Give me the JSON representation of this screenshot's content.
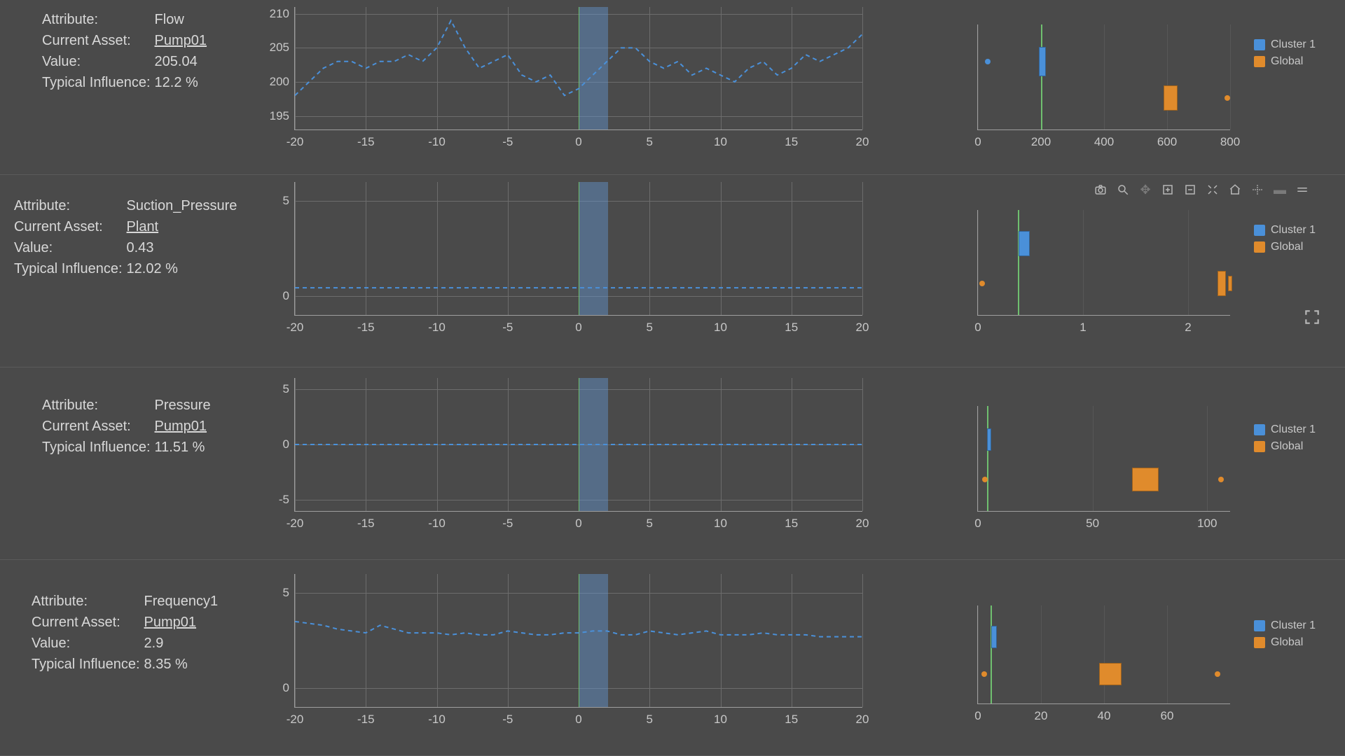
{
  "labels": {
    "attribute": "Attribute:",
    "current_asset": "Current Asset:",
    "value": "Value:",
    "typical_influence": "Typical Influence:"
  },
  "legend": {
    "cluster": "Cluster 1",
    "global": "Global"
  },
  "toolbar": {
    "camera": "camera",
    "zoom": "zoom",
    "pan": "pan",
    "zoom_in": "zoom-in",
    "zoom_out": "zoom-out",
    "autoscale": "autoscale",
    "reset": "reset",
    "spike": "spikelines",
    "hover1": "hover-closest",
    "hover2": "hover-compare",
    "expand": "expand"
  },
  "colors": {
    "cluster": "#4a90d9",
    "global": "#e08b2c",
    "marker": "#6fbf6f"
  },
  "rows": [
    {
      "attribute": "Flow",
      "asset": "Pump01",
      "value": "205.04",
      "influence": "12.2 %"
    },
    {
      "attribute": "Suction_Pressure",
      "asset": "Plant",
      "value": "0.43",
      "influence": "12.02 %"
    },
    {
      "attribute": "Pressure",
      "asset": "Pump01",
      "value": null,
      "influence": "11.51 %"
    },
    {
      "attribute": "Frequency1",
      "asset": "Pump01",
      "value": "2.9",
      "influence": "8.35 %"
    }
  ],
  "chart_data": [
    {
      "line": {
        "type": "line",
        "x_range": [
          -20,
          20
        ],
        "x_ticks": [
          -20,
          -15,
          -10,
          -5,
          0,
          5,
          10,
          15,
          20
        ],
        "y_ticks": [
          195,
          200,
          205,
          210
        ],
        "ylim": [
          193,
          211
        ],
        "highlight_x": [
          0,
          2
        ],
        "series": [
          {
            "name": "Flow",
            "x": [
              -20,
              -19,
              -18,
              -17,
              -16,
              -15,
              -14,
              -13,
              -12,
              -11,
              -10,
              -9,
              -8,
              -7,
              -6,
              -5,
              -4,
              -3,
              -2,
              -1,
              0,
              1,
              2,
              3,
              4,
              5,
              6,
              7,
              8,
              9,
              10,
              11,
              12,
              13,
              14,
              15,
              16,
              17,
              18,
              19,
              20
            ],
            "y": [
              198,
              200,
              202,
              203,
              203,
              202,
              203,
              203,
              204,
              203,
              205,
              209,
              205,
              202,
              203,
              204,
              201,
              200,
              201,
              198,
              199,
              201,
              203,
              205,
              205,
              203,
              202,
              203,
              201,
              202,
              201,
              200,
              202,
              203,
              201,
              202,
              204,
              203,
              204,
              205,
              207
            ]
          }
        ]
      },
      "box": {
        "type": "box",
        "x_range": [
          0,
          800
        ],
        "x_ticks": [
          0,
          200,
          400,
          600,
          800
        ],
        "cluster_line_x": 200,
        "items": [
          {
            "kind": "dot",
            "series": "cluster",
            "x": 30,
            "y": 0.65
          },
          {
            "kind": "box",
            "series": "cluster",
            "x": 205,
            "y": 0.65,
            "w": 8,
            "h": 40
          },
          {
            "kind": "box",
            "series": "global",
            "x": 610,
            "y": 0.3,
            "w": 18,
            "h": 34
          },
          {
            "kind": "dot",
            "series": "global",
            "x": 790,
            "y": 0.3
          }
        ]
      }
    },
    {
      "line": {
        "type": "line",
        "x_range": [
          -20,
          20
        ],
        "x_ticks": [
          -20,
          -15,
          -10,
          -5,
          0,
          5,
          10,
          15,
          20
        ],
        "y_ticks": [
          0,
          5
        ],
        "ylim": [
          -1,
          6
        ],
        "highlight_x": [
          0,
          2
        ],
        "series": [
          {
            "name": "Suction_Pressure",
            "x": [
              -20,
              -15,
              -10,
              -5,
              0,
              5,
              10,
              15,
              20
            ],
            "y": [
              0.43,
              0.43,
              0.43,
              0.43,
              0.43,
              0.43,
              0.43,
              0.43,
              0.43
            ]
          }
        ]
      },
      "box": {
        "type": "box",
        "x_range": [
          0,
          2.4
        ],
        "x_ticks": [
          0,
          1,
          2
        ],
        "cluster_line_x": 0.38,
        "items": [
          {
            "kind": "box",
            "series": "cluster",
            "x": 0.44,
            "y": 0.68,
            "w": 14,
            "h": 34
          },
          {
            "kind": "dot",
            "series": "global",
            "x": 0.04,
            "y": 0.3
          },
          {
            "kind": "box",
            "series": "global",
            "x": 2.32,
            "y": 0.3,
            "w": 10,
            "h": 34
          },
          {
            "kind": "box",
            "series": "global",
            "x": 2.4,
            "y": 0.3,
            "w": 4,
            "h": 20
          }
        ]
      }
    },
    {
      "line": {
        "type": "line",
        "x_range": [
          -20,
          20
        ],
        "x_ticks": [
          -20,
          -15,
          -10,
          -5,
          0,
          5,
          10,
          15,
          20
        ],
        "y_ticks": [
          -5,
          0,
          5
        ],
        "ylim": [
          -6,
          6
        ],
        "highlight_x": [
          0,
          2
        ],
        "series": [
          {
            "name": "Pressure",
            "x": [
              -20,
              -15,
              -10,
              -5,
              0,
              5,
              10,
              15,
              20
            ],
            "y": [
              0,
              0,
              0,
              0,
              0,
              0,
              0,
              0,
              0
            ]
          }
        ]
      },
      "box": {
        "type": "box",
        "x_range": [
          0,
          110
        ],
        "x_ticks": [
          0,
          50,
          100
        ],
        "cluster_line_x": 4,
        "items": [
          {
            "kind": "box",
            "series": "cluster",
            "x": 5,
            "y": 0.68,
            "w": 4,
            "h": 30
          },
          {
            "kind": "dot",
            "series": "global",
            "x": 3,
            "y": 0.3
          },
          {
            "kind": "box",
            "series": "global",
            "x": 73,
            "y": 0.3,
            "w": 36,
            "h": 32
          },
          {
            "kind": "dot",
            "series": "global",
            "x": 106,
            "y": 0.3
          }
        ]
      }
    },
    {
      "line": {
        "type": "line",
        "x_range": [
          -20,
          20
        ],
        "x_ticks": [
          -20,
          -15,
          -10,
          -5,
          0,
          5,
          10,
          15,
          20
        ],
        "y_ticks": [
          0,
          5
        ],
        "ylim": [
          -1,
          6
        ],
        "highlight_x": [
          0,
          2
        ],
        "series": [
          {
            "name": "Frequency1",
            "x": [
              -20,
              -19,
              -18,
              -17,
              -16,
              -15,
              -14,
              -13,
              -12,
              -11,
              -10,
              -9,
              -8,
              -7,
              -6,
              -5,
              -4,
              -3,
              -2,
              -1,
              0,
              1,
              2,
              3,
              4,
              5,
              6,
              7,
              8,
              9,
              10,
              11,
              12,
              13,
              14,
              15,
              16,
              17,
              18,
              19,
              20
            ],
            "y": [
              3.5,
              3.4,
              3.3,
              3.1,
              3.0,
              2.9,
              3.3,
              3.1,
              2.9,
              2.9,
              2.9,
              2.8,
              2.9,
              2.8,
              2.8,
              3.0,
              2.9,
              2.8,
              2.8,
              2.9,
              2.9,
              3.0,
              3.0,
              2.8,
              2.8,
              3.0,
              2.9,
              2.8,
              2.9,
              3.0,
              2.8,
              2.8,
              2.8,
              2.9,
              2.8,
              2.8,
              2.8,
              2.7,
              2.7,
              2.7,
              2.7
            ]
          }
        ]
      },
      "box": {
        "type": "box",
        "x_range": [
          0,
          80
        ],
        "x_ticks": [
          0,
          20,
          40,
          60
        ],
        "cluster_line_x": 4,
        "items": [
          {
            "kind": "box",
            "series": "cluster",
            "x": 5,
            "y": 0.68,
            "w": 6,
            "h": 30
          },
          {
            "kind": "dot",
            "series": "global",
            "x": 2,
            "y": 0.3
          },
          {
            "kind": "box",
            "series": "global",
            "x": 42,
            "y": 0.3,
            "w": 30,
            "h": 30
          },
          {
            "kind": "dot",
            "series": "global",
            "x": 76,
            "y": 0.3
          }
        ]
      }
    }
  ]
}
